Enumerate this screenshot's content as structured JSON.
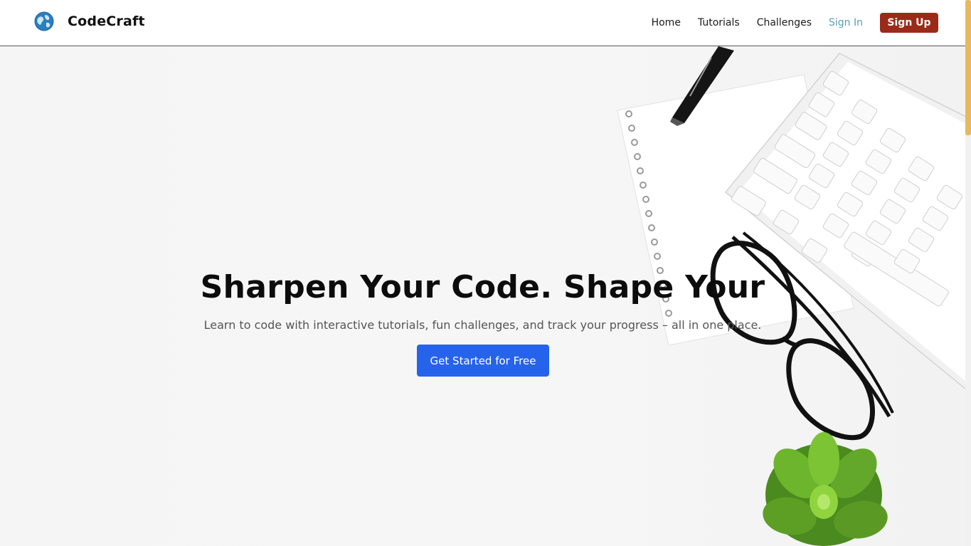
{
  "brand": {
    "name": "CodeCraft",
    "logo_icon": "globe-logo-icon"
  },
  "nav": {
    "home": "Home",
    "tutorials": "Tutorials",
    "challenges": "Challenges",
    "sign_in": "Sign In",
    "sign_up": "Sign Up"
  },
  "hero": {
    "title": "Sharpen Your Code. Shape Your",
    "subtitle": "Learn to code with interactive tutorials, fun challenges, and track your progress – all in one place.",
    "cta": "Get Started for Free"
  },
  "colors": {
    "signup_button": "#9b2a18",
    "cta_button": "#2563eb",
    "sign_in_link": "#5a9eb8",
    "scrollbar_thumb": "#e8b85a"
  }
}
